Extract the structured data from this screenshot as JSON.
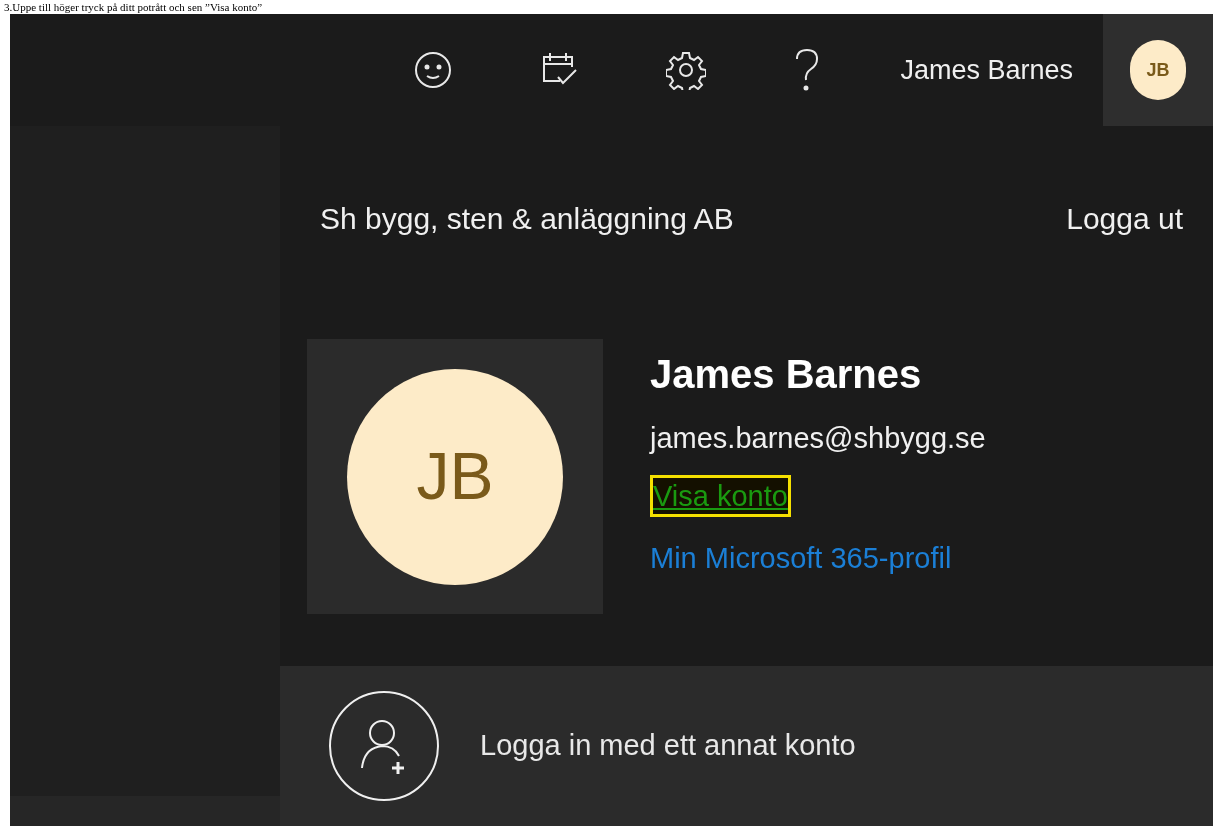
{
  "caption": "3.Uppe till höger tryck på ditt potrått och sen ”Visa konto”",
  "header": {
    "user_name": "James Barnes",
    "avatar_initials": "JB"
  },
  "account_panel": {
    "organization": "Sh bygg, sten & anläggning AB",
    "sign_out": "Logga ut",
    "avatar_initials": "JB",
    "name": "James Barnes",
    "email": "james.barnes@shbygg.se",
    "links": [
      {
        "label": "Visa konto",
        "highlighted": true
      },
      {
        "label": "Min Microsoft 365-profil",
        "highlighted": false
      }
    ],
    "other_account": "Logga in med ett annat konto"
  }
}
